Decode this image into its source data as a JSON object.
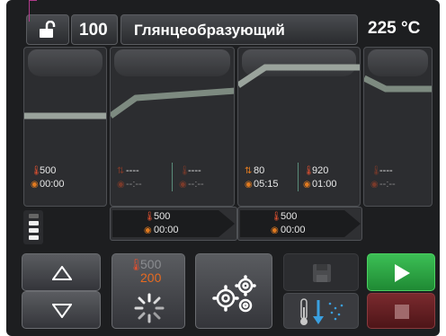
{
  "header": {
    "program_number": "100",
    "program_name": "Глянцеобразующий",
    "temperature": "225 °C"
  },
  "phases": [
    {
      "id": "predry",
      "temp": "500",
      "time": "00:00"
    },
    {
      "id": "heating",
      "rate": "----",
      "temp": "----",
      "rate_time": "--:--",
      "temp_time": "--:--"
    },
    {
      "id": "firing",
      "rate": "80",
      "temp": "920",
      "rate_time": "05:15",
      "hold_time": "01:00"
    },
    {
      "id": "cooling",
      "temp": "----",
      "time": "--:--"
    }
  ],
  "transitions": [
    {
      "temp": "500",
      "time": "00:00"
    },
    {
      "temp": "500",
      "time": "00:00"
    }
  ],
  "heat_button": {
    "top_value": "500",
    "bottom_value": "200"
  },
  "icons": {
    "lock": "unlock-icon",
    "up": "up-arrow-icon",
    "down": "down-arrow-icon",
    "heat": "loading-spinner-icon",
    "settings": "gears-icon",
    "save": "save-icon",
    "cool": "thermometer-cooling-icon",
    "start": "play-icon",
    "stop": "stop-icon"
  },
  "colors": {
    "start": "#2fa845",
    "stop": "#6e2226",
    "curve": "#9aa39c",
    "accent_red": "#e05030"
  }
}
